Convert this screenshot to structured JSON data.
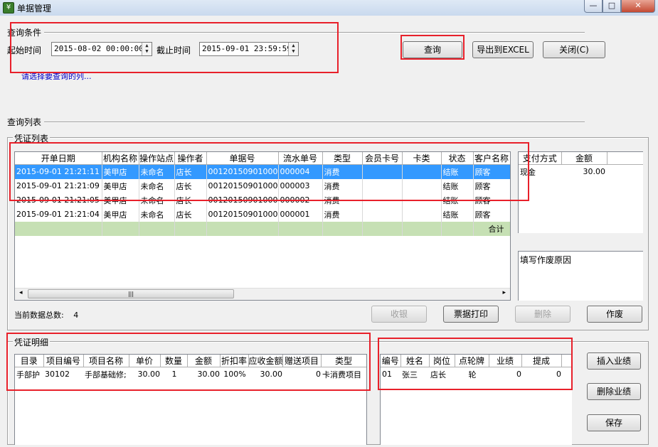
{
  "window": {
    "title": "单据管理",
    "icon_glyph": "¥",
    "min_glyph": "—",
    "max_glyph": "□",
    "close_glyph": "✕"
  },
  "query": {
    "group_label": "查询条件",
    "start_label": "起始时间",
    "start_value": "2015-08-02 00:00:00",
    "end_label": "截止时间",
    "end_value": "2015-09-01 23:59:59",
    "hint": "请选择要查询的列..."
  },
  "buttons": {
    "query": "查询",
    "export": "导出到EXCEL",
    "close": "关闭(C)",
    "cashier": "收银",
    "print": "票据打印",
    "delete": "删除",
    "void": "作废",
    "insert_perf": "插入业绩",
    "delete_perf": "删除业绩",
    "save": "保存"
  },
  "list_section": {
    "label": "查询列表",
    "voucher_label": "凭证列表"
  },
  "voucher_grid": {
    "columns": [
      "开单日期",
      "机构名称",
      "操作站点",
      "操作者",
      "单据号",
      "流水单号",
      "类型",
      "会员卡号",
      "卡类",
      "状态",
      "客户名称"
    ],
    "rows": [
      [
        "2015-09-01 21:21:11",
        "美甲店",
        "未命名",
        "店长",
        "001201509010004",
        "000004",
        "消费",
        "",
        "",
        "结账",
        "顾客"
      ],
      [
        "2015-09-01 21:21:09",
        "美甲店",
        "未命名",
        "店长",
        "001201509010003",
        "000003",
        "消费",
        "",
        "",
        "结账",
        "顾客"
      ],
      [
        "2015-09-01 21:21:05",
        "美甲店",
        "未命名",
        "店长",
        "001201509010002",
        "000002",
        "消费",
        "",
        "",
        "结账",
        "顾客"
      ],
      [
        "2015-09-01 21:21:04",
        "美甲店",
        "未命名",
        "店长",
        "001201509010001",
        "000001",
        "消费",
        "",
        "",
        "结账",
        "顾客"
      ]
    ],
    "total_label": "合计",
    "selected_row": 0
  },
  "payment_grid": {
    "columns": [
      "支付方式",
      "金额"
    ],
    "rows": [
      [
        "现金",
        "30.00"
      ]
    ]
  },
  "void_reason": {
    "label": "填写作废原因"
  },
  "count": {
    "label": "当前数据总数:",
    "value": "4"
  },
  "detail": {
    "label": "凭证明细",
    "columns": [
      "目录",
      "项目编号",
      "项目名称",
      "单价",
      "数量",
      "金额",
      "折扣率",
      "应收金额",
      "赠送项目",
      "类型"
    ],
    "rows": [
      [
        "手部护",
        "30102",
        "手部基础修;",
        "30.00",
        "1",
        "30.00",
        "100%",
        "30.00",
        "0",
        "卡消费项目"
      ]
    ]
  },
  "perf": {
    "columns": [
      "编号",
      "姓名",
      "岗位",
      "点轮牌",
      "业绩",
      "提成"
    ],
    "rows": [
      [
        "01",
        "张三",
        "店长",
        "轮",
        "0",
        "0"
      ]
    ]
  },
  "colors": {
    "highlight": "#e8202a",
    "selection": "#3399ff",
    "total_row": "#c6e0b4",
    "link": "#0000c8"
  },
  "icons": {
    "scroll_left": "◂",
    "scroll_right": "▸",
    "spin_up": "▲",
    "spin_down": "▼",
    "thumb_grip": "|||"
  }
}
